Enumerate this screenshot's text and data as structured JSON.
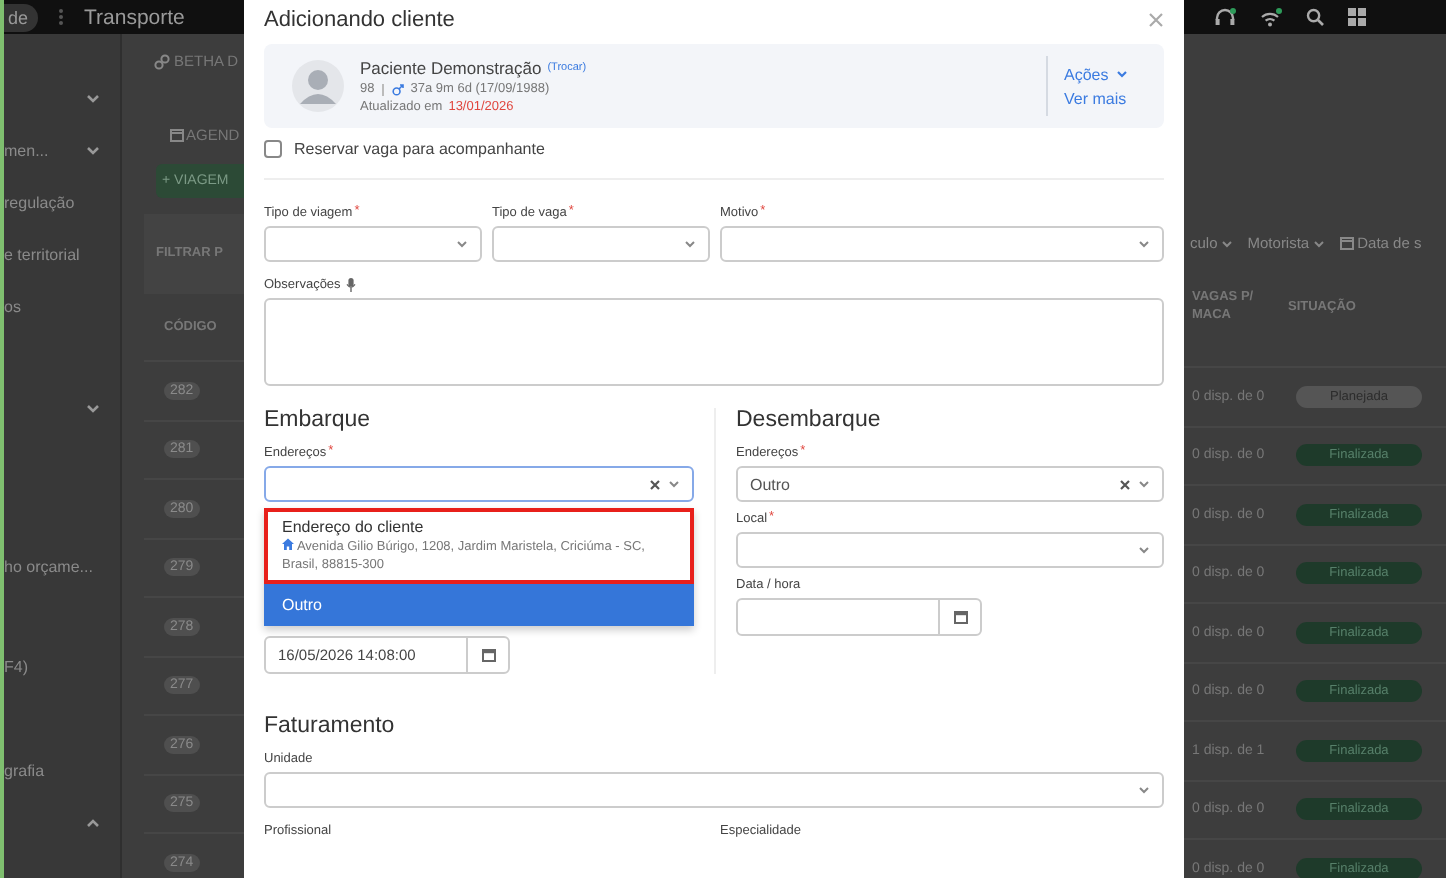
{
  "top_bar": {
    "home_label": "de",
    "title": "Transporte"
  },
  "sidebar": {
    "items": [
      {
        "kind": "group",
        "expanded": false
      },
      {
        "kind": "group",
        "label": "men...",
        "expanded": false
      },
      {
        "kind": "link",
        "label": "regulação"
      },
      {
        "kind": "link",
        "label": "e territorial"
      },
      {
        "kind": "link",
        "label": "os"
      },
      {
        "kind": "group",
        "expanded": false
      },
      {
        "kind": "link",
        "label": "ho orçame..."
      },
      {
        "kind": "link",
        "label": "F4)"
      },
      {
        "kind": "link",
        "label": "grafia"
      },
      {
        "kind": "group",
        "expanded": true
      }
    ]
  },
  "page": {
    "breadcrumb": "BETHA D",
    "tab": "AGEND",
    "new_button": "+ VIAGEM",
    "filter_title": "FILTRAR P",
    "filters": [
      "culo",
      "Motorista",
      "Data de s"
    ]
  },
  "table": {
    "columns": [
      "CÓDIGO",
      "VAGAS P/ MACA",
      "SITUAÇÃO"
    ],
    "rows": [
      {
        "code": "282",
        "seats": "0 disp. de 0",
        "status": "Planejada",
        "kind": "planned"
      },
      {
        "code": "281",
        "seats": "0 disp. de 0",
        "status": "Finalizada",
        "kind": "finished"
      },
      {
        "code": "280",
        "seats": "0 disp. de 0",
        "status": "Finalizada",
        "kind": "finished"
      },
      {
        "code": "279",
        "seats": "0 disp. de 0",
        "status": "Finalizada",
        "kind": "finished"
      },
      {
        "code": "278",
        "seats": "0 disp. de 0",
        "status": "Finalizada",
        "kind": "finished"
      },
      {
        "code": "277",
        "seats": "0 disp. de 0",
        "status": "Finalizada",
        "kind": "finished"
      },
      {
        "code": "276",
        "seats": "1 disp. de 1",
        "status": "Finalizada",
        "kind": "finished"
      },
      {
        "code": "275",
        "seats": "0 disp. de 0",
        "status": "Finalizada",
        "kind": "finished"
      },
      {
        "code": "274",
        "seats": "0 disp. de 0",
        "status": "Finalizada",
        "kind": "finished"
      }
    ]
  },
  "modal": {
    "title": "Adicionando cliente",
    "patient": {
      "name": "Paciente Demonstração",
      "change_link": "(Trocar)",
      "id": "98",
      "age": "37a 9m 6d (17/09/1988)",
      "updated_label": "Atualizado em",
      "updated_date": "13/01/2026",
      "actions": "Ações",
      "more": "Ver mais"
    },
    "companion_checkbox": {
      "label": "Reservar vaga para acompanhante",
      "checked": false
    },
    "fields": [
      {
        "label": "Tipo de viagem",
        "required_mark": "*"
      },
      {
        "label": "Tipo de vaga",
        "required_mark": "*"
      },
      {
        "label": "Motivo",
        "required_mark": "*"
      }
    ],
    "notes": {
      "label": "Observações"
    },
    "boarding": {
      "title": "Embarque",
      "address": {
        "label": "Endereços",
        "required_mark": "*"
      },
      "options": [
        {
          "title": "Endereço do cliente",
          "address": "Avenida Gilio Búrigo, 1208, Jardim Maristela, Criciúma - SC, Brasil, 88815-300",
          "selected": false,
          "highlighted": true
        },
        {
          "title": "Outro",
          "selected": true,
          "highlighted": false
        }
      ],
      "datetime": "16/05/2026 14:08:00"
    },
    "landing": {
      "title": "Desembarque",
      "address": {
        "label": "Endereços",
        "required_mark": "*",
        "value": "Outro"
      },
      "local": {
        "label": "Local",
        "required_mark": "*"
      },
      "datetime_label": "Data / hora"
    },
    "billing": {
      "title": "Faturamento",
      "unit_label": "Unidade",
      "professional_label": "Profissional",
      "specialty_label": "Especialidade"
    }
  }
}
